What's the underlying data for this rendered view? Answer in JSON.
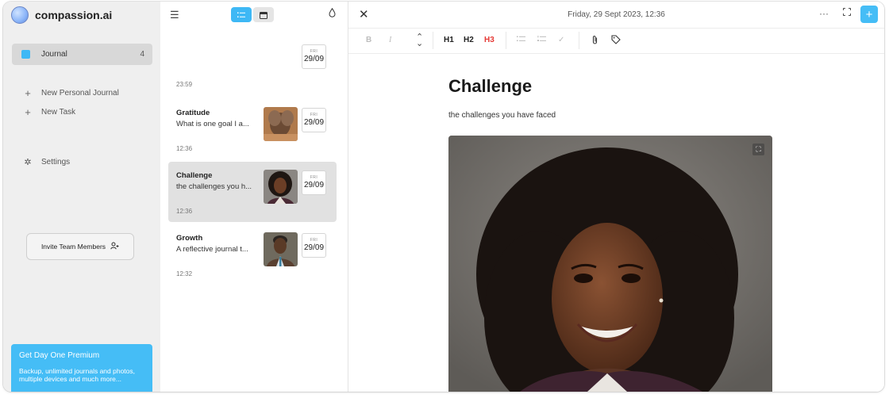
{
  "app": {
    "name": "compassion.ai"
  },
  "sidebar": {
    "journal_label": "Journal",
    "journal_count": "4",
    "links": [
      {
        "label": "New Personal Journal"
      },
      {
        "label": "New Task"
      }
    ],
    "settings_label": "Settings",
    "invite_label": "Invite Team Members",
    "premium": {
      "title": "Get Day One Premium",
      "description": "Backup, unlimited journals and photos, multiple devices and much more..."
    }
  },
  "list": {
    "top_date": {
      "weekday": "FRI",
      "day": "29/09"
    },
    "top_time": "23:59",
    "entries": [
      {
        "title": "Gratitude",
        "snippet": "What is one goal I a...",
        "weekday": "FRI",
        "day": "29/09",
        "time": "12:36",
        "selected": false
      },
      {
        "title": "Challenge",
        "snippet": "the challenges you h...",
        "weekday": "FRI",
        "day": "29/09",
        "time": "12:36",
        "selected": true
      },
      {
        "title": "Growth",
        "snippet": "A reflective journal t...",
        "weekday": "FRI",
        "day": "29/09",
        "time": "12:32",
        "selected": false
      }
    ]
  },
  "editor": {
    "datetime": "Friday, 29 Sept 2023, 12:36",
    "toolbar": {
      "bold": "B",
      "italic": "I",
      "h1": "H1",
      "h2": "H2",
      "h3": "H3"
    },
    "title": "Challenge",
    "body": "the challenges you have faced"
  },
  "colors": {
    "accent": "#45bdf6",
    "h3": "#e53935"
  }
}
